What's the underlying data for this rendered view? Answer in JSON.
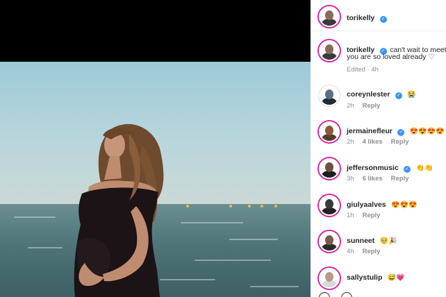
{
  "post": {
    "author": "torikelly",
    "caption": "can't wait to meet you you are so loved already ♡",
    "caption_line1": "can't wait to meet",
    "caption_line2": "you are so loved already ♡",
    "caption_meta": "Edited · 4h"
  },
  "comments": [
    {
      "user": "coreynlester",
      "verified": true,
      "emoji": "😭",
      "time": "2h",
      "likes": "",
      "reply": "Reply"
    },
    {
      "user": "jermainefleur",
      "verified": true,
      "emoji": "😍😍😍😍",
      "time": "2h",
      "likes": "4 likes",
      "reply": "Reply"
    },
    {
      "user": "jeffersonmusic",
      "verified": true,
      "emoji": "👏👏",
      "time": "3h",
      "likes": "6 likes",
      "reply": "Reply"
    },
    {
      "user": "giulyaalves",
      "verified": false,
      "emoji": "😍😍😍",
      "time": "1h",
      "likes": "",
      "reply": "Reply"
    },
    {
      "user": "sunneet",
      "verified": false,
      "emoji": "🥺🎉",
      "time": "4h",
      "likes": "",
      "reply": "Reply"
    },
    {
      "user": "sallystulip",
      "verified": false,
      "emoji": "😅💗",
      "time": "",
      "likes": "",
      "reply": ""
    }
  ],
  "icons": {
    "verified": "verified-badge-icon",
    "like": "heart-icon",
    "comment": "comment-icon"
  },
  "colors": {
    "verified": "#3897f0",
    "story_ring": "#d6249f",
    "meta": "#8e8e8e"
  }
}
